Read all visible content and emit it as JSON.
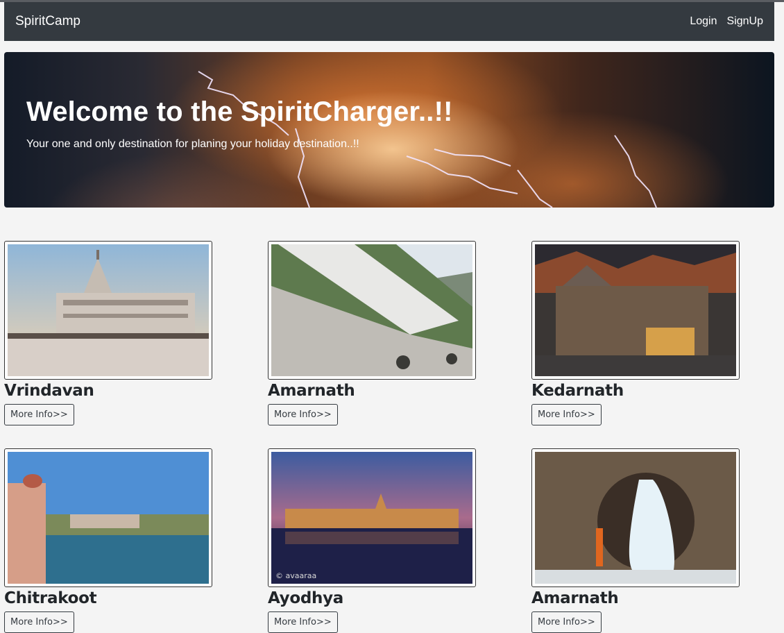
{
  "navbar": {
    "brand": "SpiritCamp",
    "links": [
      "Login",
      "SignUp"
    ]
  },
  "hero": {
    "title": "Welcome to the SpiritCharger..!!",
    "subtitle": "Your one and only destination for planing your holiday destination..!!"
  },
  "places": [
    {
      "name": "Vrindavan",
      "button": "More Info>>"
    },
    {
      "name": "Amarnath",
      "button": "More Info>>"
    },
    {
      "name": "Kedarnath",
      "button": "More Info>>"
    },
    {
      "name": "Chitrakoot",
      "button": "More Info>>"
    },
    {
      "name": "Ayodhya",
      "button": "More Info>>",
      "watermark": "© avaaraa"
    },
    {
      "name": "Amarnath",
      "button": "More Info>>"
    }
  ],
  "colors": {
    "navbar_bg": "#343a40",
    "page_bg": "#f4f4f4",
    "button_border": "#343a40"
  }
}
